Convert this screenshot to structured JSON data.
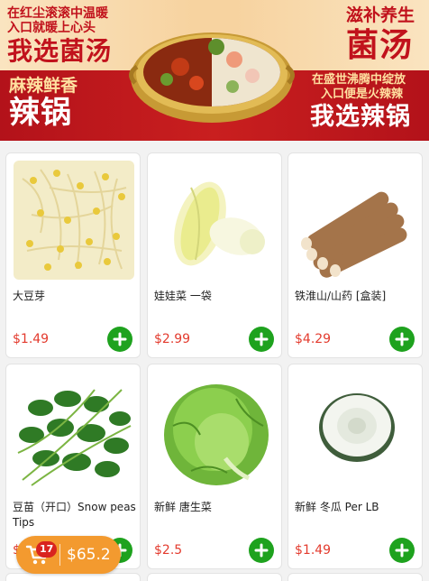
{
  "banner": {
    "left_top_line1": "在红尘滚滚中温暖",
    "left_top_line2": "入口就暖上心头",
    "left_top_big": "我选菌汤",
    "right_top_small": "滋补养生",
    "right_top_big": "菌汤",
    "left_bottom_small": "麻辣鲜香",
    "left_bottom_big": "辣锅",
    "right_bottom_line1": "在盛世沸腾中绽放",
    "right_bottom_line2": "入口便是火辣辣",
    "right_bottom_big": "我选辣锅"
  },
  "products": [
    {
      "name": "大豆芽",
      "price": "$1.49",
      "icon": "bean-sprouts-image"
    },
    {
      "name": "娃娃菜 一袋",
      "price": "$2.99",
      "icon": "baby-cabbage-image"
    },
    {
      "name": "铁淮山/山药 [盒装]",
      "price": "$4.29",
      "icon": "yam-image"
    },
    {
      "name": "豆苗（开口）Snow peas Tips",
      "price": "$",
      "icon": "pea-shoots-image"
    },
    {
      "name": "新鲜 唐生菜",
      "price": "$2.5",
      "icon": "lettuce-image"
    },
    {
      "name": "新鲜 冬瓜 Per LB",
      "price": "$1.49",
      "icon": "winter-melon-image"
    }
  ],
  "cart": {
    "count": "17",
    "total": "$65.2",
    "icon": "cart-icon"
  },
  "colors": {
    "price": "#e33b2e",
    "add_button": "#1ea21e",
    "cart": "#f39a2f",
    "badge": "#d9231f"
  }
}
